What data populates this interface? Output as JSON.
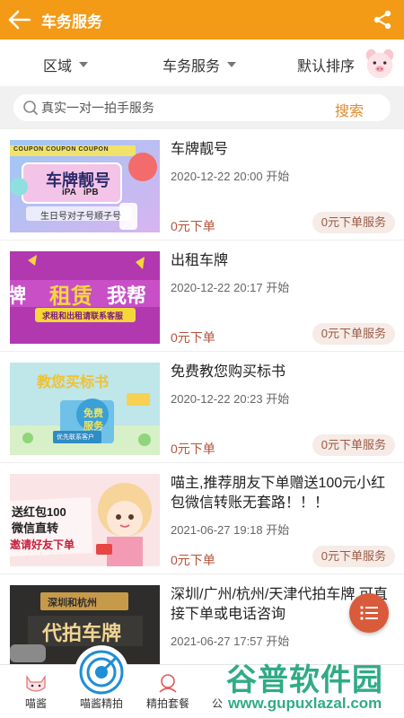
{
  "header": {
    "title": "车务服务",
    "back_icon": "arrow-left-icon",
    "share_icon": "share-icon",
    "color": "#f39a17"
  },
  "filters": {
    "region": "区域",
    "service": "车务服务",
    "sort": "默认排序"
  },
  "search": {
    "placeholder": "真实一对一拍手服务",
    "button": "搜索"
  },
  "items": [
    {
      "title": "车牌靓号",
      "date": "2020-12-22 20:00 开始",
      "price": "0元下单",
      "service": "0元下单服务",
      "thumb": {
        "main": "车牌靓号",
        "sub1": "iPA   iPB",
        "sub2": "生日号对子号顺子号",
        "coupon": "COUPON  COUPON  COUPON"
      }
    },
    {
      "title": "出租车牌",
      "date": "2020-12-22 20:17 开始",
      "price": "0元下单",
      "service": "0元下单服务",
      "thumb": {
        "main1": "牌",
        "main2": "租赁",
        "main3": "我帮",
        "sub": "求租和出租请联系客服"
      }
    },
    {
      "title": "免费教您购买标书",
      "date": "2020-12-22 20:23 开始",
      "price": "0元下单",
      "service": "0元下单服务",
      "thumb": {
        "main": "教您买标书",
        "badge1": "免费",
        "badge2": "服务",
        "tag": "优先联系客户"
      }
    },
    {
      "title": "喵主,推荐朋友下单赠送100元小红包微信转账无套路！！！",
      "date": "2021-06-27 19:18 开始",
      "price": "0元下单",
      "service": "0元下单服务",
      "thumb": {
        "line1": "送红包100",
        "line2": "微信直转",
        "line3": "邀请好友下单"
      }
    },
    {
      "title": "深圳/广州/杭州/天津代拍车牌,可直接下单或电话咨询",
      "date": "2021-06-27 17:57 开始",
      "thumb": {
        "top": "深圳和杭州",
        "main": "代拍车牌"
      }
    }
  ],
  "nav": [
    {
      "label": "喵酱",
      "icon": "cat-face-icon"
    },
    {
      "label": "喵酱精拍",
      "icon": "target-icon"
    },
    {
      "label": "精拍套餐",
      "icon": "avatar-icon"
    },
    {
      "label": "公",
      "icon": ""
    }
  ],
  "watermark": {
    "line1": "谷普软件园",
    "line2": "www.gupuxlazal.com"
  }
}
